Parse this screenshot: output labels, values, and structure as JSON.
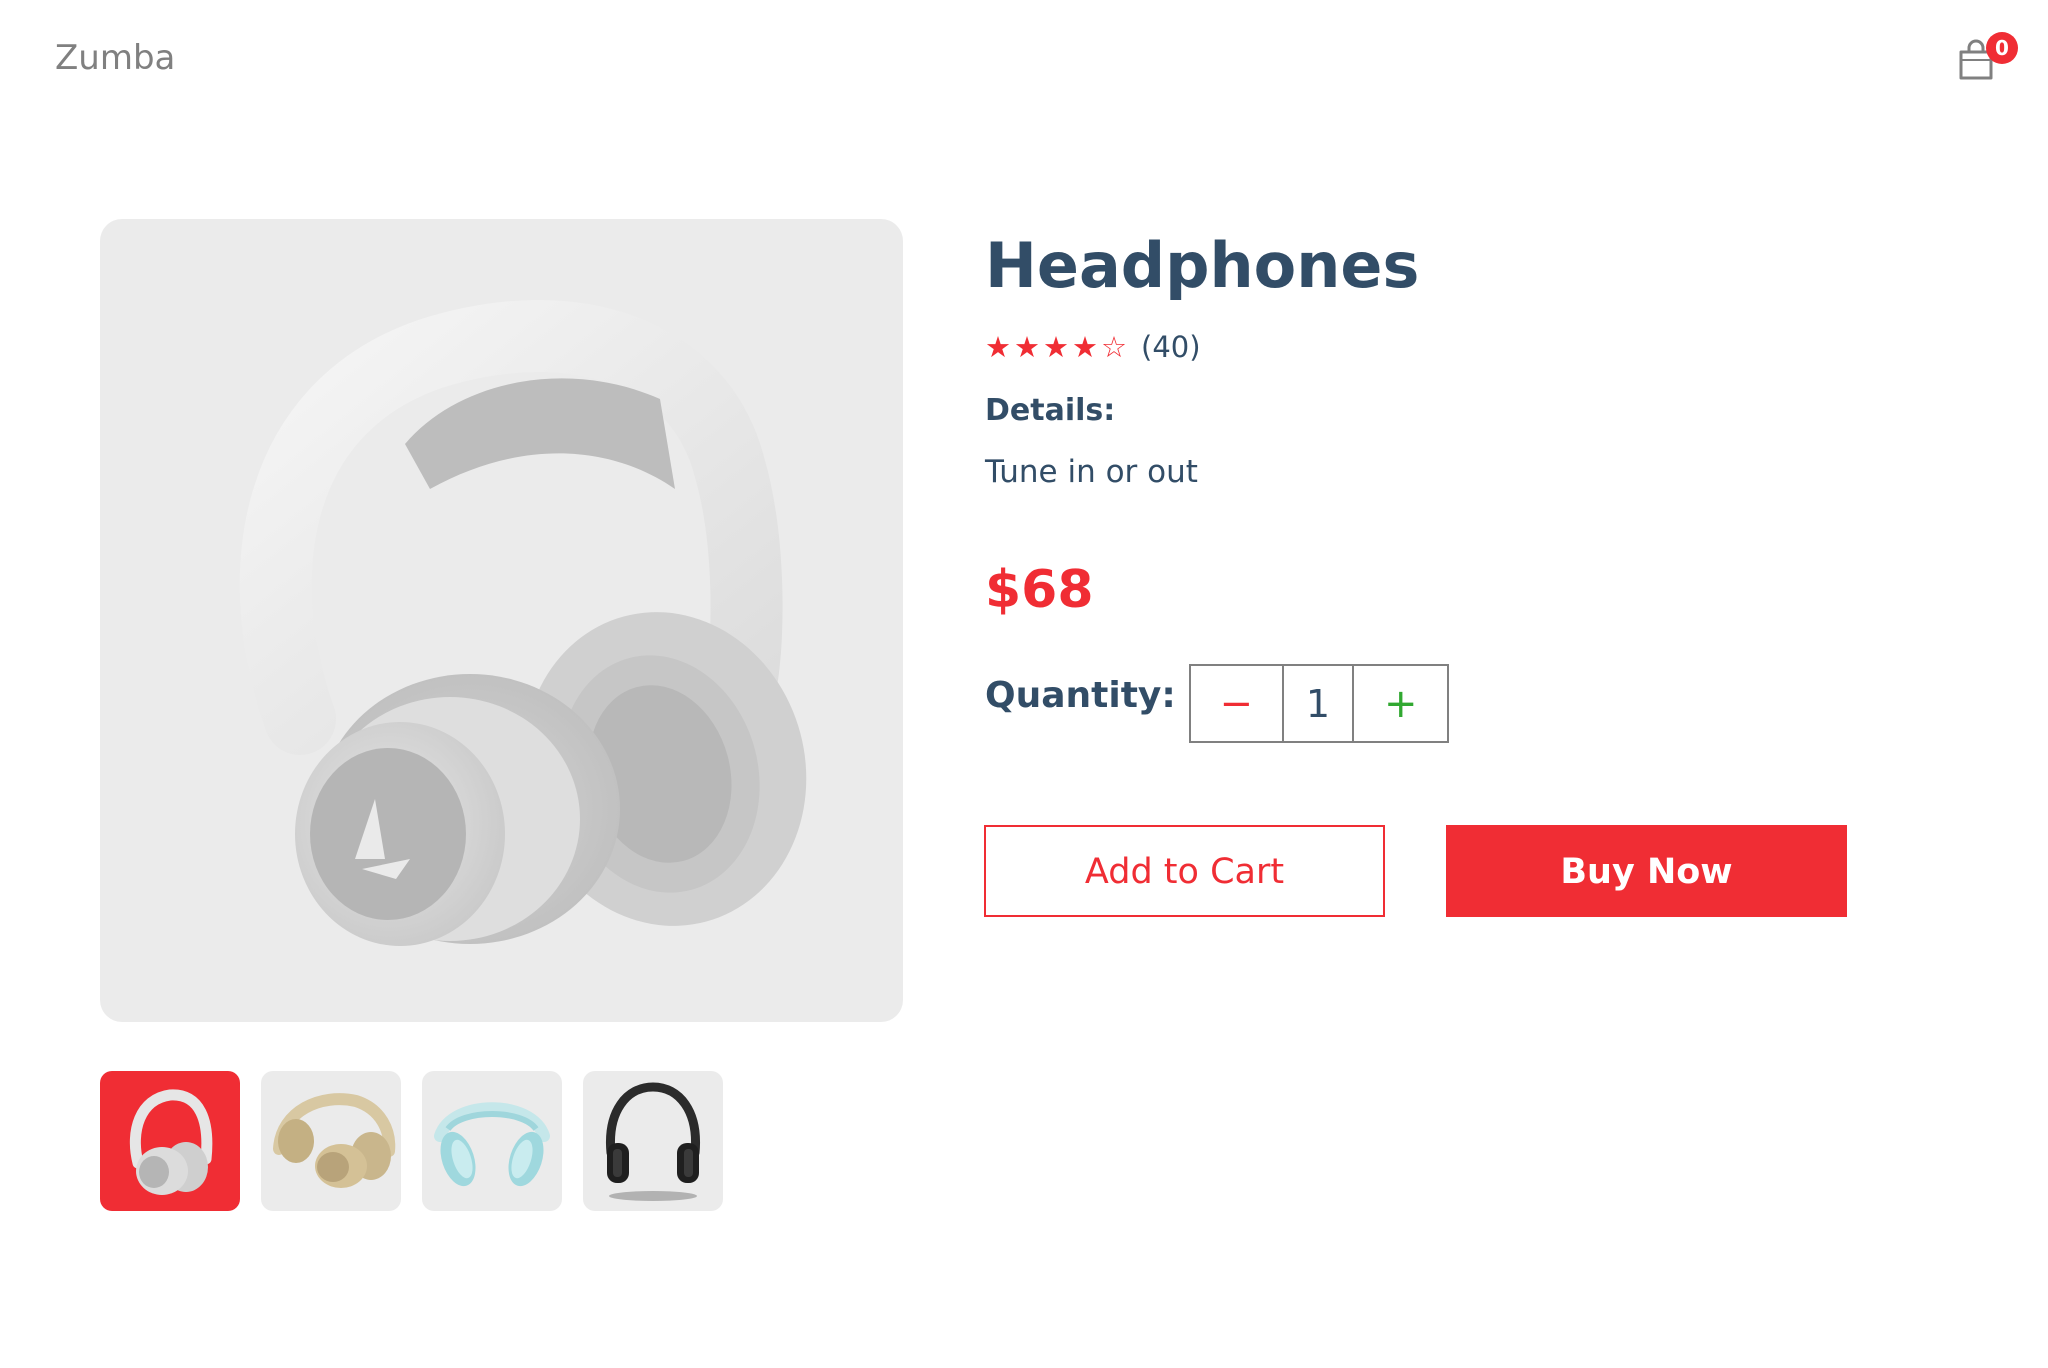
{
  "header": {
    "brand": "Zumba",
    "cart_count": "0",
    "cart_icon": "shopping-bag-icon"
  },
  "gallery": {
    "main_image": "white-headphones",
    "thumbnails": [
      {
        "name": "white-headphones",
        "selected": true
      },
      {
        "name": "beige-headphones",
        "selected": false
      },
      {
        "name": "mint-headphones",
        "selected": false
      },
      {
        "name": "black-headphones",
        "selected": false
      }
    ]
  },
  "product": {
    "title": "Headphones",
    "rating": 4,
    "rating_max": 5,
    "stars": [
      "★",
      "★",
      "★",
      "★",
      "☆"
    ],
    "review_count": "(40)",
    "details_label": "Details:",
    "details_text": "Tune in or out",
    "price": "$68"
  },
  "quantity": {
    "label": "Quantity:",
    "minus": "−",
    "value": "1",
    "plus": "+"
  },
  "actions": {
    "add_to_cart": "Add to Cart",
    "buy_now": "Buy Now"
  },
  "colors": {
    "accent": "#f02d34",
    "heading": "#324d67",
    "muted": "#808080",
    "panel": "#ebebeb",
    "plus": "#31a831"
  }
}
